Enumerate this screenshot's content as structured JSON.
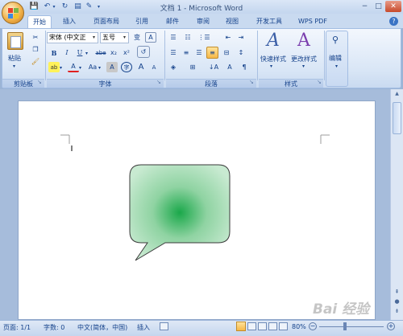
{
  "titlebar": {
    "title": "文档 1 - Microsoft Word",
    "minimize": "−",
    "maximize": "□",
    "close": "✕"
  },
  "tabs": [
    {
      "label": "开始",
      "active": true
    },
    {
      "label": "插入"
    },
    {
      "label": "页面布局"
    },
    {
      "label": "引用"
    },
    {
      "label": "邮件"
    },
    {
      "label": "审阅"
    },
    {
      "label": "视图"
    },
    {
      "label": "开发工具"
    },
    {
      "label": "WPS PDF"
    }
  ],
  "clipboard": {
    "paste": "粘贴",
    "group": "剪贴板"
  },
  "font": {
    "name": "宋体 (中文正",
    "size": "五号",
    "group": "字体",
    "bold": "B",
    "italic": "I",
    "underline": "U",
    "strike": "abe",
    "subscript": "x₂",
    "superscript": "x²",
    "change_case": "Aa",
    "char_border": "A",
    "char_shading": "A",
    "enclose": "字",
    "grow": "A",
    "shrink": "A"
  },
  "paragraph": {
    "group": "段落"
  },
  "styles": {
    "quick": "快速样式",
    "change": "更改样式",
    "group": "样式"
  },
  "editing": {
    "label": "编辑"
  },
  "statusbar": {
    "page": "页面: 1/1",
    "words": "字数: 0",
    "language": "中文(简体，中国)",
    "mode": "插入",
    "zoom": "80%"
  },
  "watermark": "Bai 经验"
}
